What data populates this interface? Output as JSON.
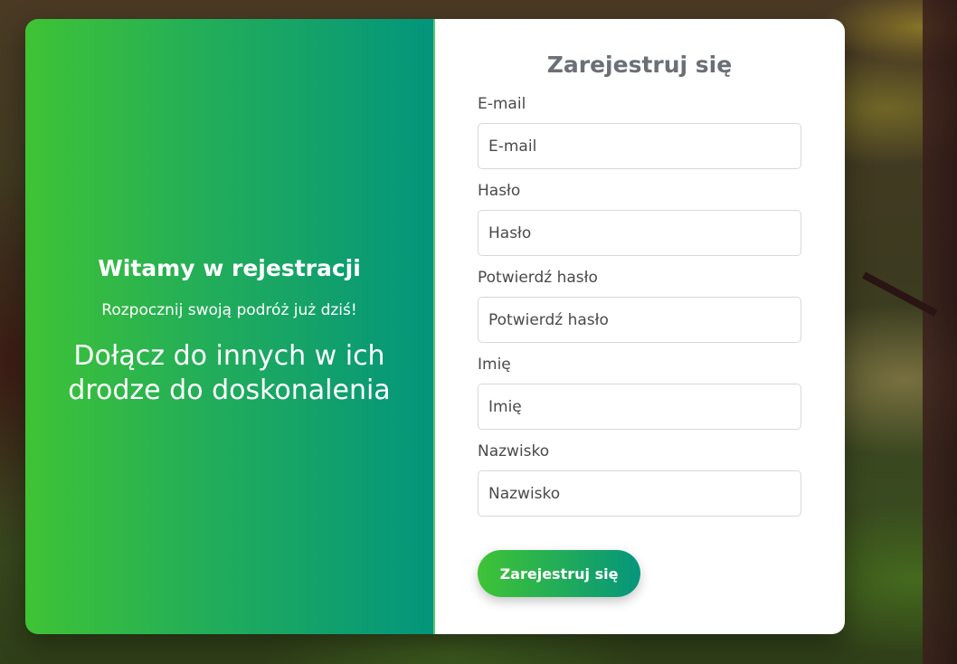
{
  "left": {
    "heading": "Witamy w rejestracji",
    "subtitle": "Rozpocznij swoją podróż już dziś!",
    "tagline": "Dołącz do innych w ich drodze do doskonalenia"
  },
  "form": {
    "title": "Zarejestruj się",
    "fields": [
      {
        "label": "E-mail",
        "placeholder": "E-mail",
        "value": ""
      },
      {
        "label": "Hasło",
        "placeholder": "Hasło",
        "value": ""
      },
      {
        "label": "Potwierdź hasło",
        "placeholder": "Potwierdź hasło",
        "value": ""
      },
      {
        "label": "Imię",
        "placeholder": "Imię",
        "value": ""
      },
      {
        "label": "Nazwisko",
        "placeholder": "Nazwisko",
        "value": ""
      }
    ],
    "submit_label": "Zarejestruj się"
  },
  "colors": {
    "gradient_start": "#3fc335",
    "gradient_end": "#03957c",
    "title_text": "#6b6f76"
  }
}
